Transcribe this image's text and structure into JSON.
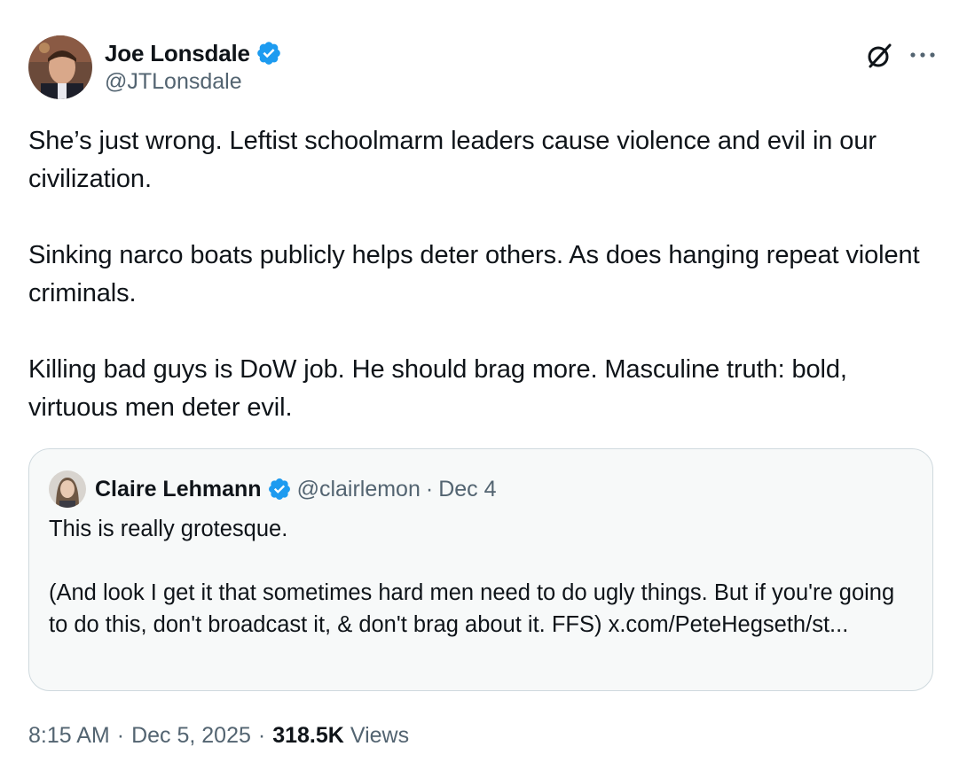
{
  "author": {
    "name": "Joe Lonsdale",
    "handle": "@JTLonsdale",
    "verified": true
  },
  "tweet": {
    "paragraphs": [
      "She’s just wrong. Leftist schoolmarm leaders cause violence and evil in our civilization.",
      "Sinking narco boats publicly helps deter others. As does hanging repeat violent criminals.",
      "Killing bad guys is DoW job. He should brag more. Masculine truth: bold, virtuous men deter evil."
    ]
  },
  "quoted": {
    "name": "Claire Lehmann",
    "handle": "@clairlemon",
    "separator": "·",
    "date": "Dec 4",
    "verified": true,
    "paragraphs": [
      "This is really grotesque.",
      "(And look I get it that sometimes hard men need to do ugly things. But if you're going to do this, don't broadcast it, & don't brag about it. FFS) x.com/PeteHegseth/st..."
    ]
  },
  "meta": {
    "time": "8:15 AM",
    "sep1": "·",
    "date": "Dec 5, 2025",
    "sep2": "·",
    "views_count": "318.5K",
    "views_label": "Views"
  },
  "icons": {
    "verified": "verified-badge-icon",
    "grok": "grok-icon",
    "more": "more-options-icon"
  },
  "colors": {
    "verified_blue": "#1d9bf0",
    "text_primary": "#0f1419",
    "text_secondary": "#536471",
    "quote_border": "#cfd9de",
    "quote_bg": "#f7f9f9"
  }
}
